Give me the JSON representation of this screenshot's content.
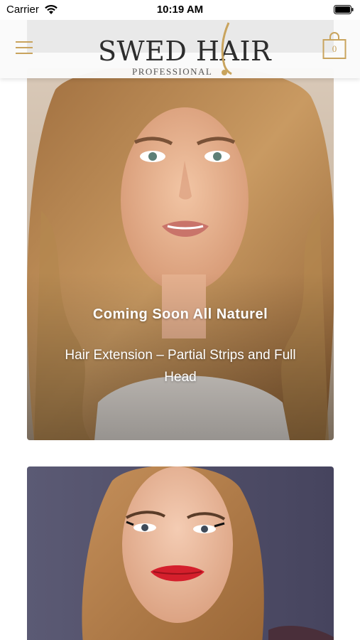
{
  "status_bar": {
    "carrier": "Carrier",
    "time": "10:19 AM",
    "wifi_icon": "wifi-icon",
    "battery_icon": "battery-icon"
  },
  "header": {
    "menu_icon": "hamburger-menu-icon",
    "logo": {
      "main": "SWED HAIR",
      "sub": "PROFESSIONAL"
    },
    "cart": {
      "icon": "shopping-bag-icon",
      "count": "0"
    }
  },
  "cards": [
    {
      "title": "Coming Soon All Naturel",
      "subtitle": "Hair Extension – Partial Strips and Full Head"
    },
    {
      "title": "",
      "subtitle": ""
    }
  ],
  "colors": {
    "accent_gold": "#c9a45e",
    "logo_text": "#2d2d2d",
    "header_bg": "#fafafa"
  }
}
